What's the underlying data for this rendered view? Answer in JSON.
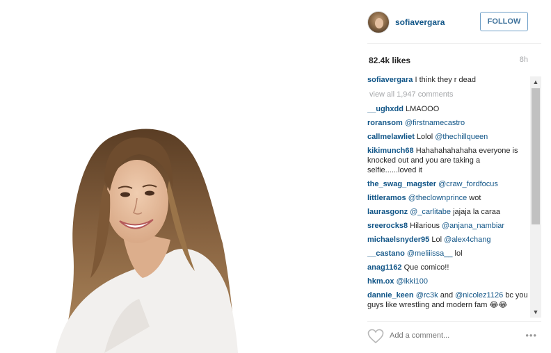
{
  "post": {
    "username": "sofiavergara",
    "follow_label": "FOLLOW",
    "likes": "82.4k likes",
    "time": "8h",
    "caption_user": "sofiavergara",
    "caption_text": " I think they r dead",
    "view_all": "view all 1,947 comments",
    "add_comment_placeholder": "Add a comment...",
    "more": "•••"
  },
  "comments": [
    {
      "user": "__ughxdd",
      "text": " LMAOOO",
      "mention": ""
    },
    {
      "user": "roransom",
      "text": " ",
      "mention": "@firstnamecastro"
    },
    {
      "user": "callmelawliet",
      "text": " Lolol ",
      "mention": "@thechillqueen"
    },
    {
      "user": "kikimunch68",
      "text": " Hahahahahahaha everyone is knocked out and you are taking a selfie......loved it",
      "mention": ""
    },
    {
      "user": "the_swag_magster",
      "text": " ",
      "mention": "@craw_fordfocus"
    },
    {
      "user": "littleramos",
      "text": " ",
      "mention": "@theclownprince",
      "suffix": " wot"
    },
    {
      "user": "laurasgonz",
      "text": " ",
      "mention": "@_carlitabe",
      "suffix": " jajaja la caraa"
    },
    {
      "user": "sreerocks8",
      "text": " Hilarious ",
      "mention": "@anjana_nambiar"
    },
    {
      "user": "michaelsnyder95",
      "text": " Lol ",
      "mention": "@alex4chang"
    },
    {
      "user": "__castano",
      "text": " ",
      "mention": "@meliiissa__",
      "suffix": " lol"
    },
    {
      "user": "anag1162",
      "text": " Que comico!!",
      "mention": ""
    },
    {
      "user": "hkm.ox",
      "text": " ",
      "mention": "@ikki100"
    },
    {
      "user": "dannie_keen",
      "text": " ",
      "mention": "@rc3k",
      "suffix": " and ",
      "mention2": "@nicolez1126",
      "suffix2": " bc you guys like wrestling and modern fam 😂😂"
    }
  ],
  "scroll": {
    "up": "▲",
    "down": "▼"
  }
}
